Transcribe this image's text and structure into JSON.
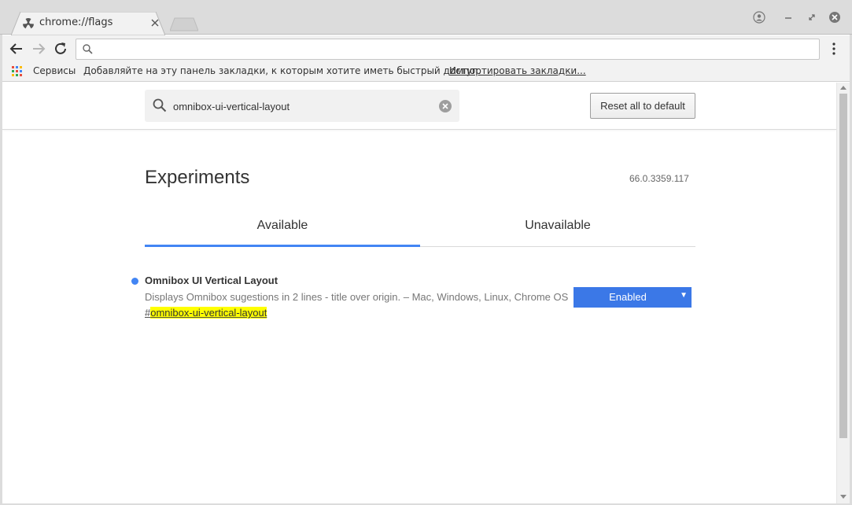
{
  "browser": {
    "tab_title": "chrome://flags",
    "omnibox_value": "",
    "bookmarks": {
      "apps_label": "Сервисы",
      "hint": "Добавляйте на эту панель закладки, к которым хотите иметь быстрый доступ.",
      "import_link": "Импортировать закладки..."
    }
  },
  "flags_page": {
    "search_value": "omnibox-ui-vertical-layout",
    "reset_button": "Reset all to default",
    "title": "Experiments",
    "version": "66.0.3359.117",
    "tabs": [
      {
        "label": "Available",
        "active": true
      },
      {
        "label": "Unavailable",
        "active": false
      }
    ],
    "flags": [
      {
        "name": "Omnibox UI Vertical Layout",
        "description": "Displays Omnibox sugestions in 2 lines - title over origin. – Mac, Windows, Linux, Chrome OS",
        "hash": "#",
        "id": "omnibox-ui-vertical-layout",
        "state": "Enabled"
      }
    ]
  },
  "colors": {
    "accent": "#4285f4",
    "select_bg": "#3b78e7",
    "highlight": "#ffff00"
  },
  "icons": [
    "radiation-favicon-icon",
    "tab-close-icon",
    "profile-icon",
    "minimize-icon",
    "restore-icon",
    "window-close-icon",
    "back-icon",
    "forward-icon",
    "reload-icon",
    "search-icon",
    "menu-icon",
    "apps-icon",
    "clear-search-icon"
  ]
}
